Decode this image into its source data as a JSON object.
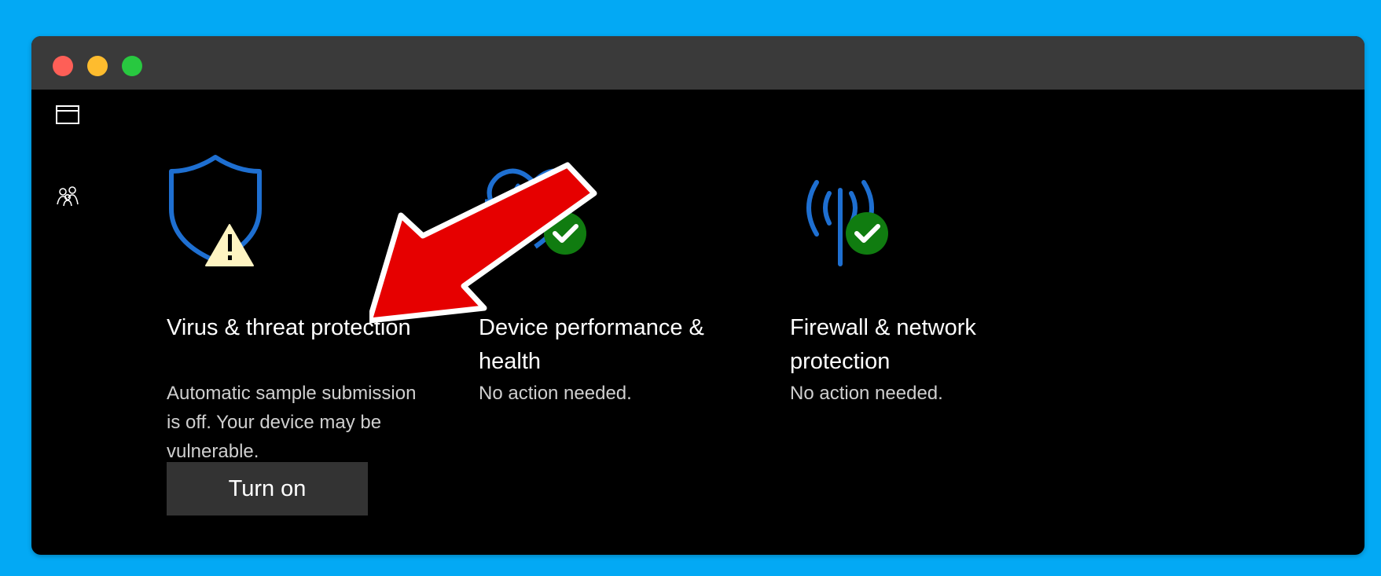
{
  "window": {
    "controls": [
      "close",
      "minimize",
      "maximize"
    ]
  },
  "sidebar": {
    "items": [
      {
        "icon": "app-browser-icon"
      },
      {
        "icon": "family-icon"
      }
    ]
  },
  "cards": [
    {
      "id": "virus",
      "icon": "shield-warning-icon",
      "title": "Virus & threat protection",
      "description": "Automatic sample submission is off. Your device may be vulnerable.",
      "status": "warning"
    },
    {
      "id": "device",
      "icon": "heart-check-icon",
      "title": "Device performance & health",
      "description": "No action needed.",
      "status": "ok"
    },
    {
      "id": "firewall",
      "icon": "antenna-check-icon",
      "title": "Firewall & network protection",
      "description": "No action needed.",
      "status": "ok"
    }
  ],
  "actions": {
    "turn_on_label": "Turn on"
  },
  "colors": {
    "background": "#03a9f4",
    "window": "#000000",
    "titlebar": "#3a3a3a",
    "icon_blue": "#1e6fd1",
    "ok_green": "#107c10",
    "warning_yellow": "#fff4c2",
    "annotation_arrow": "#e60000"
  },
  "annotation": {
    "type": "arrow",
    "points_to": "Virus & threat protection"
  }
}
